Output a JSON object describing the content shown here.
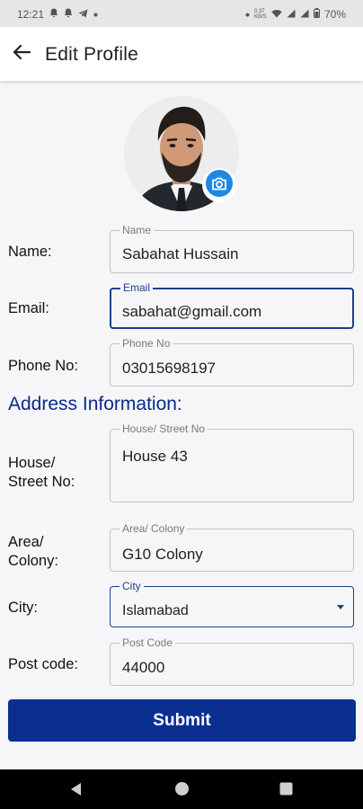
{
  "status_bar": {
    "time": "12:21",
    "left_icons": [
      "notification-icon",
      "notification-icon",
      "telegram-icon",
      "dot-icon"
    ],
    "right_icons": [
      "dot-icon",
      "data-speed-icon",
      "wifi-icon",
      "signal-icon",
      "signal-icon",
      "battery-icon"
    ],
    "data_speed": "0.37\nKB/S",
    "battery": "70%"
  },
  "app_bar": {
    "title": "Edit Profile",
    "back_icon": "arrow-left-icon"
  },
  "profile": {
    "camera_icon": "camera-icon",
    "accent": "#1e88e5"
  },
  "fields": {
    "name": {
      "row_label": "Name:",
      "float_label": "Name",
      "value": "Sabahat Hussain"
    },
    "email": {
      "row_label": "Email:",
      "float_label": "Email",
      "value": "sabahat@gmail.com",
      "focused": true
    },
    "phone": {
      "row_label": "Phone No:",
      "float_label": "Phone No",
      "value": "03015698197"
    },
    "house": {
      "row_label_line1": "House/",
      "row_label_line2": "Street No:",
      "float_label": "House/ Street No",
      "value": "House 43"
    },
    "area": {
      "row_label_line1": "Area/",
      "row_label_line2": "Colony:",
      "float_label": "Area/ Colony",
      "value": "G10 Colony"
    },
    "city": {
      "row_label": "City:",
      "float_label": "City",
      "value": "Islamabad"
    },
    "postcode": {
      "row_label": "Post code:",
      "float_label": "Post Code",
      "value": "44000"
    }
  },
  "section": {
    "address_title": "Address Information:"
  },
  "submit": {
    "label": "Submit",
    "color": "#0a2f91"
  },
  "nav": {
    "back": "triangle-back-icon",
    "home": "circle-home-icon",
    "recents": "square-recents-icon"
  }
}
